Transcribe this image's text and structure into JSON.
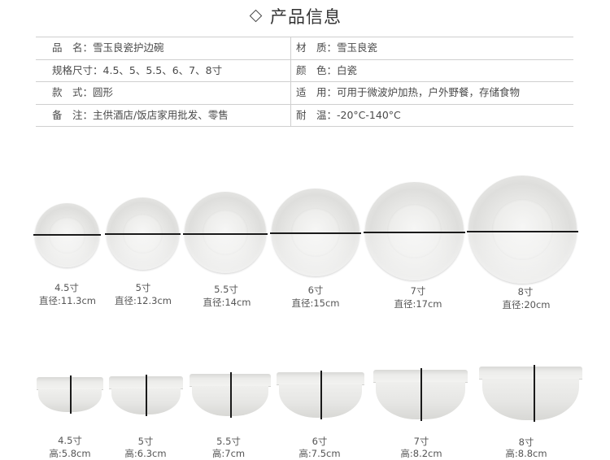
{
  "header": {
    "title": "产品信息"
  },
  "info": {
    "rows": [
      {
        "left_label": "品　名：",
        "left_value": "雪玉良瓷护边碗",
        "right_label": "材　质：",
        "right_value": "雪玉良瓷"
      },
      {
        "left_label": "规格尺寸：",
        "left_value": "4.5、5、5.5、6、7、8寸",
        "right_label": "颜　色：",
        "right_value": "白瓷"
      },
      {
        "left_label": "款　式：",
        "left_value": "圆形",
        "right_label": "适　用：",
        "right_value": "可用于微波炉加热，户外野餐，存储食物"
      },
      {
        "left_label": "备　注：",
        "left_value": "主供酒店/饭店家用批发、零售",
        "right_label": "耐　温：",
        "right_value": "-20°C-140°C"
      }
    ]
  },
  "top_view": [
    {
      "size": "4.5寸",
      "diameter": "直径:11.3cm"
    },
    {
      "size": "5寸",
      "diameter": "直径:12.3cm"
    },
    {
      "size": "5.5寸",
      "diameter": "直径:14cm"
    },
    {
      "size": "6寸",
      "diameter": "直径:15cm"
    },
    {
      "size": "7寸",
      "diameter": "直径:17cm"
    },
    {
      "size": "8寸",
      "diameter": "直径:20cm"
    }
  ],
  "side_view": [
    {
      "size": "4.5寸",
      "height": "高:5.8cm"
    },
    {
      "size": "5寸",
      "height": "高:6.3cm"
    },
    {
      "size": "5.5寸",
      "height": "高:7cm"
    },
    {
      "size": "6寸",
      "height": "高:7.5cm"
    },
    {
      "size": "7寸",
      "height": "高:8.2cm"
    },
    {
      "size": "8寸",
      "height": "高:8.8cm"
    }
  ]
}
